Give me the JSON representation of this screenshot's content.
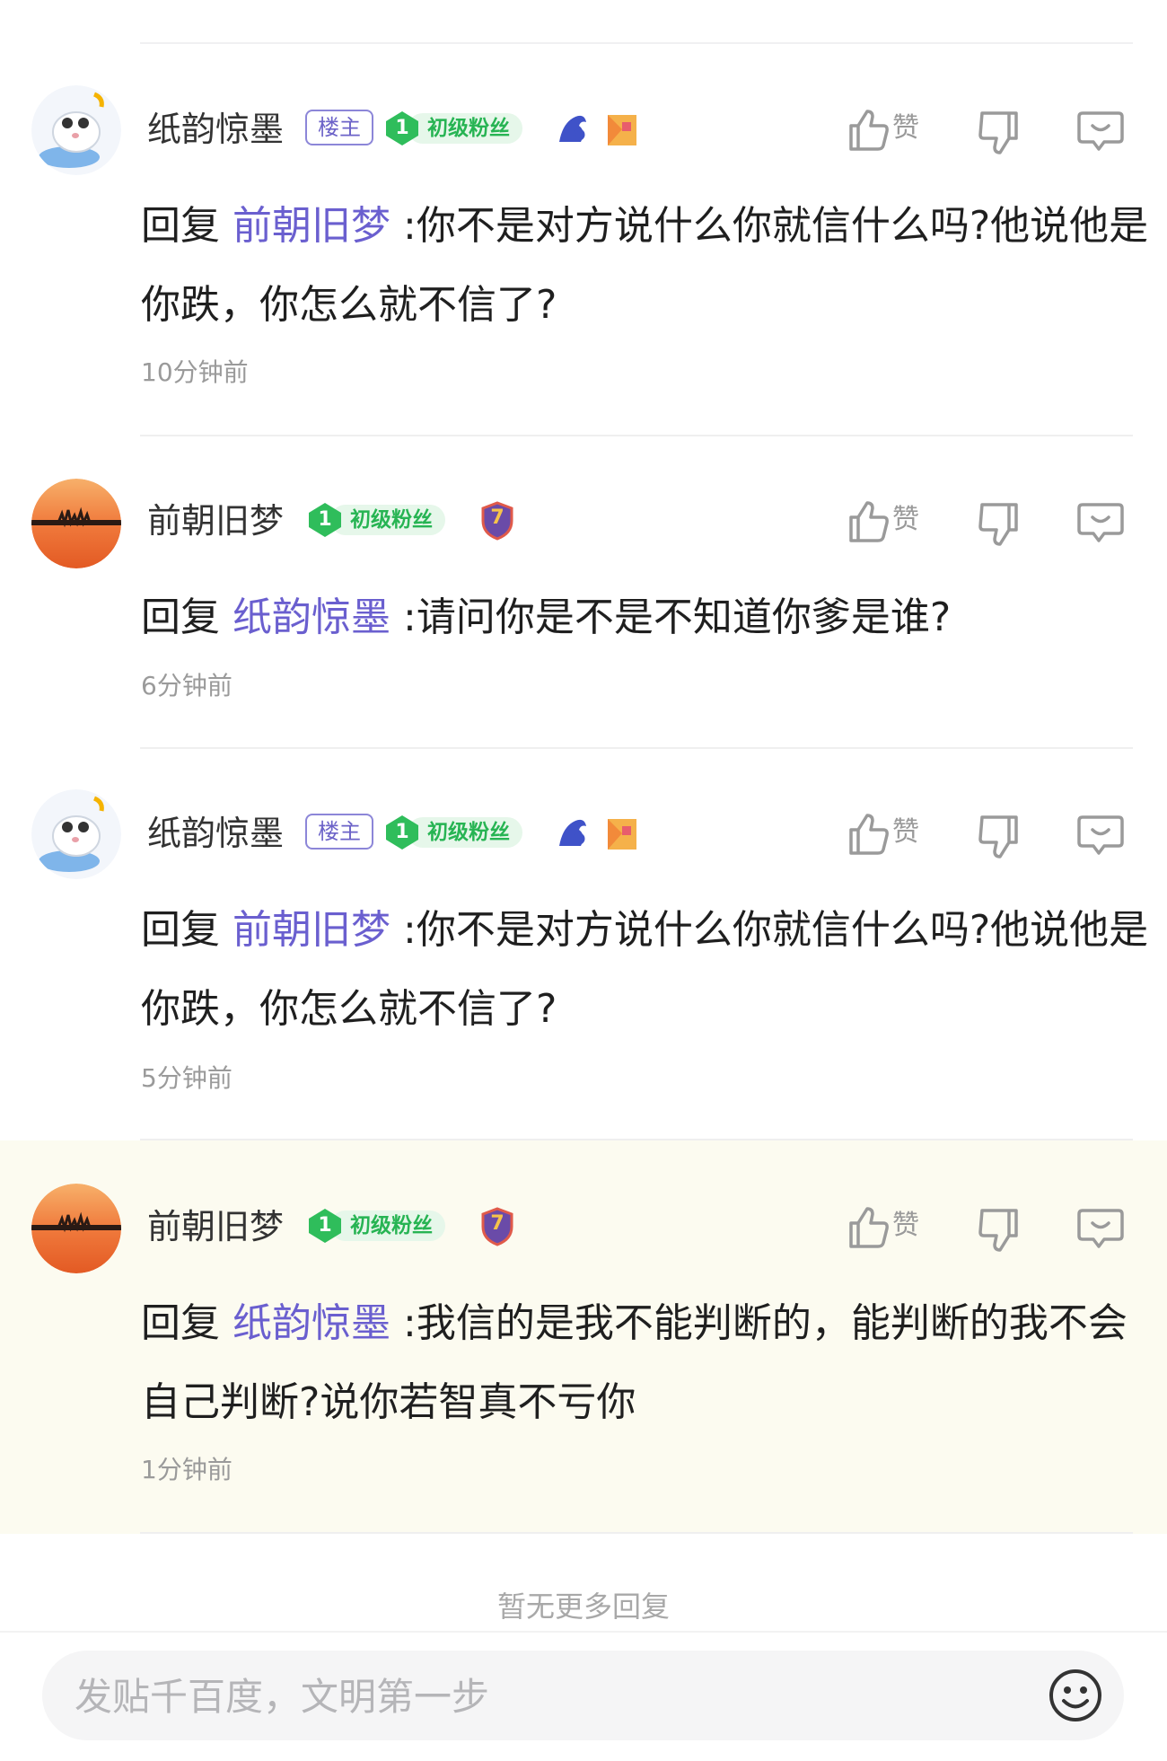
{
  "comments": [
    {
      "user": "纸韵惊墨",
      "owner_badge": "楼主",
      "fan_level": "1",
      "fan_label": "初级粉丝",
      "like_label": "赞",
      "reply_prefix": "回复",
      "reply_to": "前朝旧梦",
      "text": ":你不是对方说什么你就信什么吗?他说他是你跌，你怎么就不信了?",
      "time": "10分钟前"
    },
    {
      "user": "前朝旧梦",
      "fan_level": "1",
      "fan_label": "初级粉丝",
      "level_badge": "7",
      "like_label": "赞",
      "reply_prefix": "回复",
      "reply_to": "纸韵惊墨",
      "text": ":请问你是不是不知道你爹是谁?",
      "time": "6分钟前"
    },
    {
      "user": "纸韵惊墨",
      "owner_badge": "楼主",
      "fan_level": "1",
      "fan_label": "初级粉丝",
      "like_label": "赞",
      "reply_prefix": "回复",
      "reply_to": "前朝旧梦",
      "text": ":你不是对方说什么你就信什么吗?他说他是你跌，你怎么就不信了?",
      "time": "5分钟前"
    },
    {
      "user": "前朝旧梦",
      "fan_level": "1",
      "fan_label": "初级粉丝",
      "level_badge": "7",
      "like_label": "赞",
      "reply_prefix": "回复",
      "reply_to": "纸韵惊墨",
      "text": ":我信的是我不能判断的，能判断的我不会自己判断?说你若智真不亏你",
      "time": "1分钟前"
    }
  ],
  "no_more": "暂无更多回复",
  "input": {
    "placeholder": "发贴千百度，文明第一步"
  },
  "colors": {
    "mention": "#6a5fcf",
    "fan_green": "#27b453",
    "owner_purple": "#6c63c8",
    "highlight_bg": "#fcfbf0"
  }
}
